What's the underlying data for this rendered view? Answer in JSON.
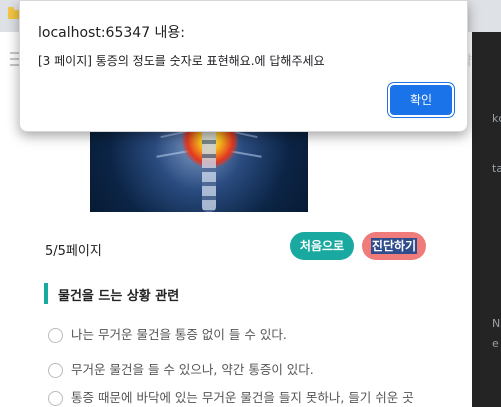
{
  "dialog": {
    "title": "localhost:65347 내용:",
    "message": "[3 페이지] 통증의 정도를 숫자로 표현해요.에 답해주세요",
    "ok_label": "확인"
  },
  "header": {
    "faint_text": "약"
  },
  "pager": {
    "text": "5/5페이지",
    "first_label": "처음으로",
    "diagnose_label": "진단하기"
  },
  "section": {
    "title": "물건을 드는 상황 관련"
  },
  "options": [
    "나는 무거운 물건을 통증 없이 들 수 있다.",
    "무거운 물건을 들 수 있으나, 약간 통증이 있다.",
    "통증 때문에 바닥에 있는 무거운 물건을 들지 못하나, 들기 쉬운 곳"
  ],
  "devtools": {
    "fragments": [
      "kc",
      "ta",
      "e",
      "N"
    ]
  },
  "colors": {
    "accent_teal": "#1aa9a1",
    "diagnose_pink": "#ef7b7b",
    "dialog_button_blue": "#1a73e8"
  }
}
